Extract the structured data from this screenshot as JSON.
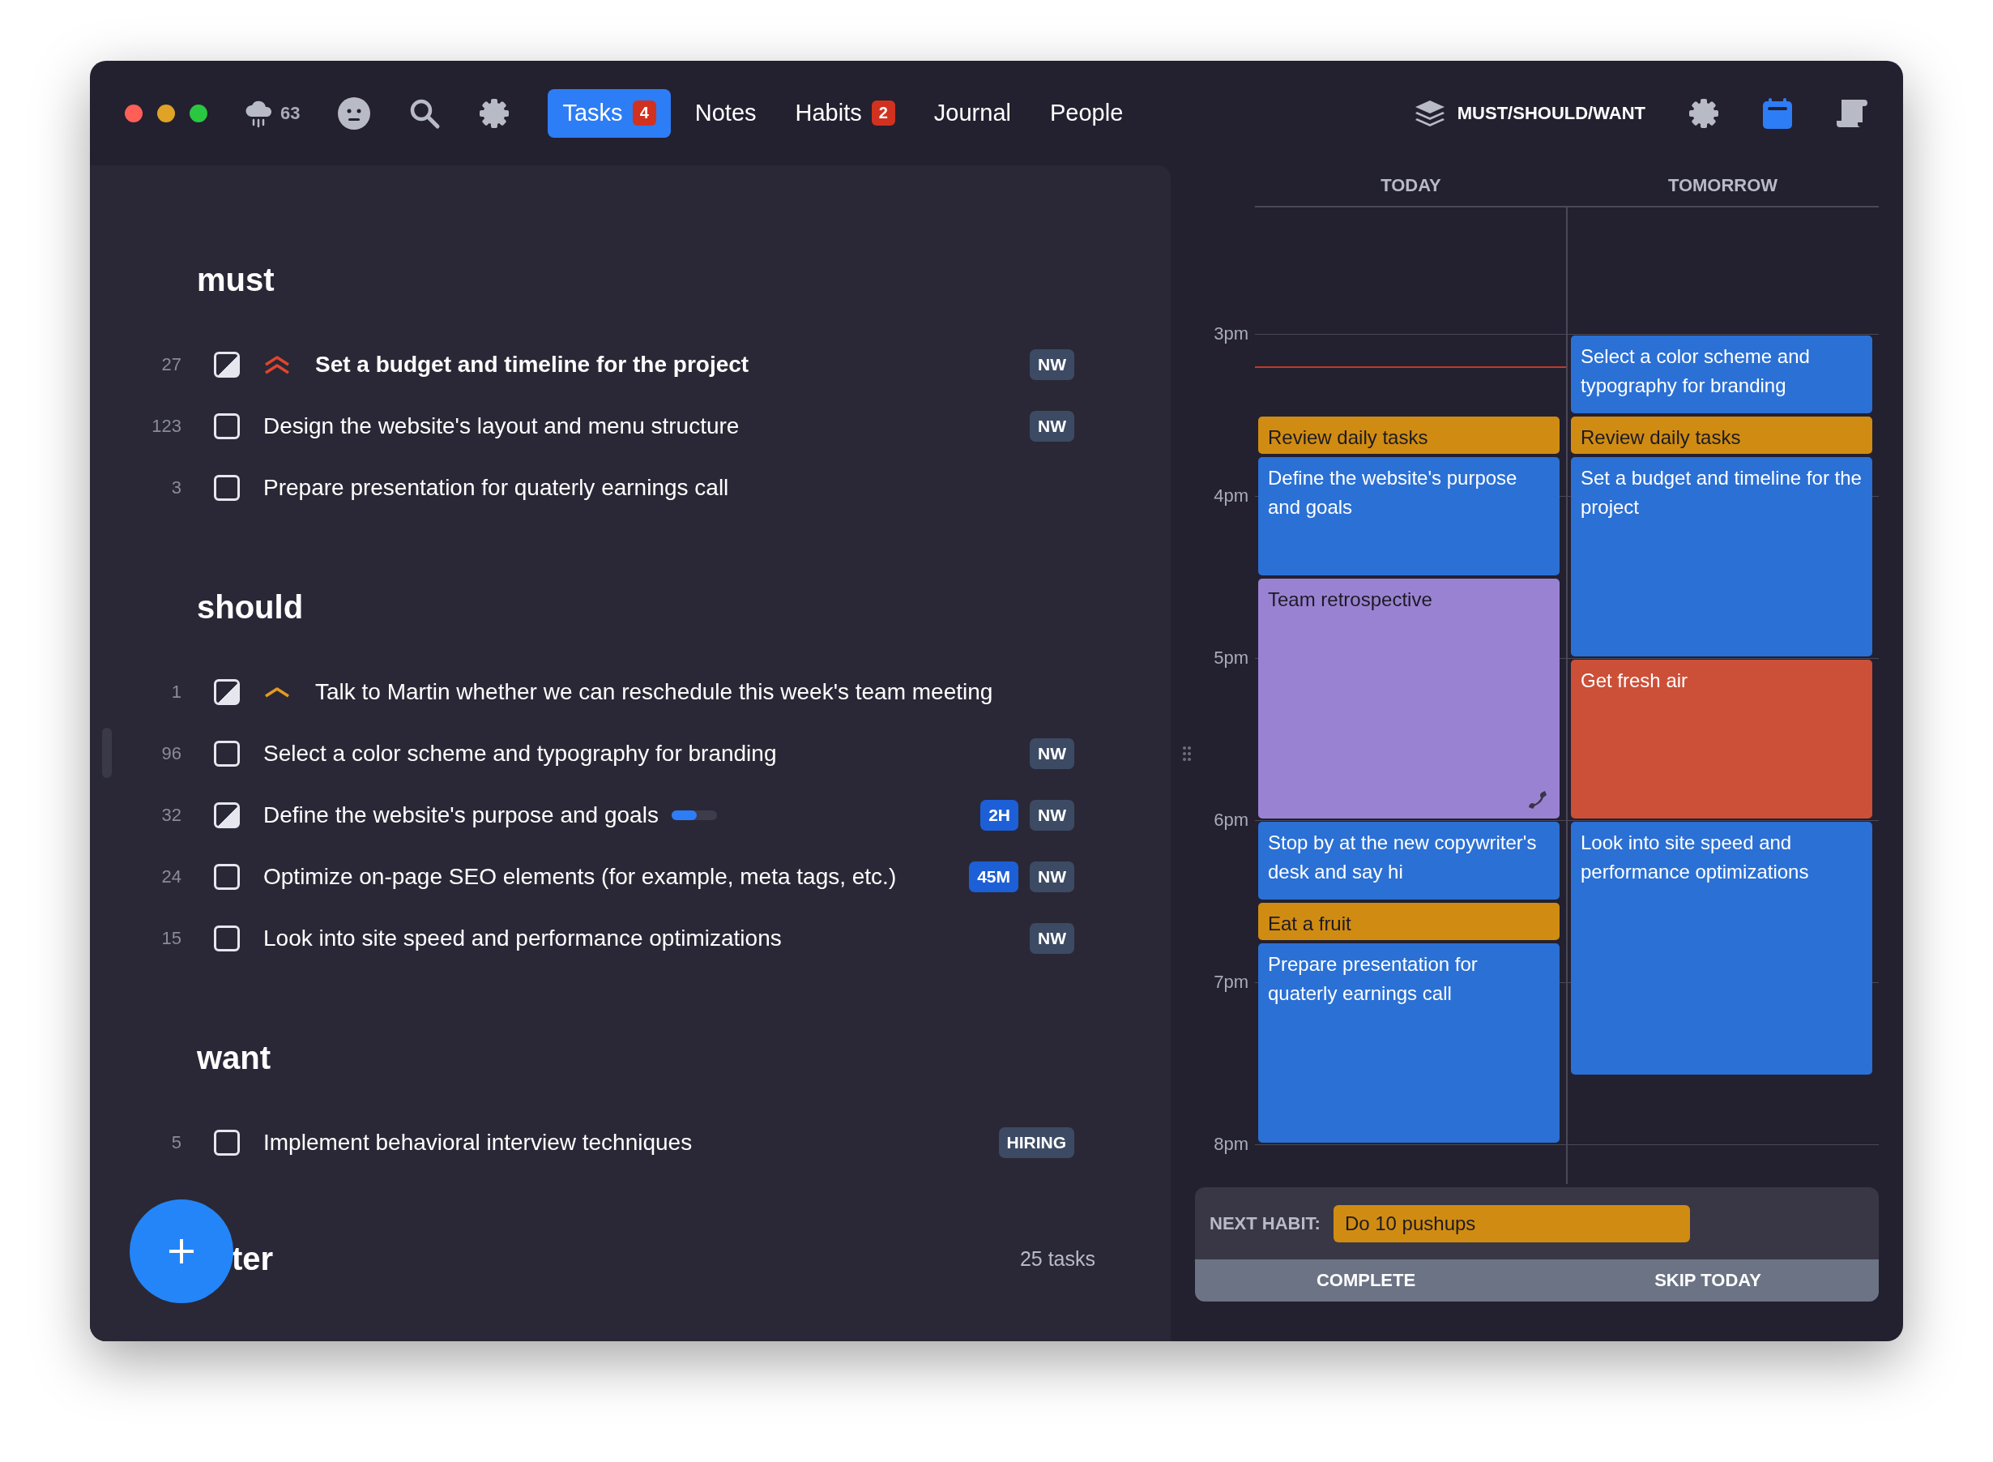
{
  "window": {
    "controls": [
      {
        "color": "#fe5f57"
      },
      {
        "color": "#e0a326"
      },
      {
        "color": "#2ac840"
      }
    ]
  },
  "toolbar": {
    "weather": {
      "temperature": "63"
    },
    "tabs": [
      {
        "label": "Tasks",
        "selected": true,
        "badge": "4"
      },
      {
        "label": "Notes",
        "selected": false
      },
      {
        "label": "Habits",
        "selected": false,
        "badge": "2"
      },
      {
        "label": "Journal",
        "selected": false
      },
      {
        "label": "People",
        "selected": false
      }
    ],
    "view_switch": {
      "label": "MUST/SHOULD/WANT"
    },
    "buttons": [
      {
        "kind": "settings",
        "selected": false
      },
      {
        "kind": "calendar",
        "selected": true
      },
      {
        "kind": "scroll",
        "selected": false
      }
    ]
  },
  "sections": [
    {
      "title": "must",
      "tasks": [
        {
          "number": "27",
          "title": "Set a budget and timeline for the project",
          "in_progress": true,
          "kind": "high",
          "tags": [
            {
              "label": "NW",
              "kind": "project"
            }
          ]
        },
        {
          "number": "123",
          "title": "Design the website's layout and menu structure",
          "in_progress": false,
          "tags": [
            {
              "label": "NW",
              "kind": "project"
            }
          ]
        },
        {
          "number": "3",
          "title": "Prepare presentation for quaterly earnings call",
          "in_progress": false
        }
      ]
    },
    {
      "title": "should",
      "tasks": [
        {
          "number": "1",
          "title": "Talk to Martin whether we can reschedule this week's team meeting",
          "in_progress": true,
          "kind": "medium"
        },
        {
          "number": "96",
          "title": "Select a color scheme and typography for branding",
          "in_progress": false,
          "tags": [
            {
              "label": "NW",
              "kind": "project"
            }
          ]
        },
        {
          "number": "32",
          "title": "Define the website's purpose and goals",
          "in_progress": true,
          "progress": {
            "level": 0.55
          },
          "tags": [
            {
              "label": "2H",
              "kind": "estimate"
            },
            {
              "label": "NW",
              "kind": "project"
            }
          ]
        },
        {
          "number": "24",
          "title": "Optimize on-page SEO elements (for example, meta tags, etc.)",
          "in_progress": false,
          "tags": [
            {
              "label": "45M",
              "kind": "estimate"
            },
            {
              "label": "NW",
              "kind": "project"
            }
          ]
        },
        {
          "number": "15",
          "title": "Look into site speed and performance optimizations",
          "in_progress": false,
          "tags": [
            {
              "label": "NW",
              "kind": "project"
            }
          ]
        }
      ]
    },
    {
      "title": "want",
      "tasks": [
        {
          "number": "5",
          "title": "Implement behavioral interview techniques",
          "in_progress": false,
          "tags": [
            {
              "label": "HIRING",
              "kind": "project"
            }
          ]
        }
      ]
    }
  ],
  "later": {
    "title": "ter",
    "count": "25 tasks"
  },
  "calendar": {
    "hours": [
      "3pm",
      "4pm",
      "5pm",
      "6pm",
      "7pm",
      "8pm"
    ],
    "columns": [
      {
        "label": "TODAY",
        "events": [
          {
            "title": "Review daily tasks",
            "kind": "habit",
            "color": "#d08c12"
          },
          {
            "title": "Define the website's purpose and goals",
            "kind": "task",
            "color": "#2b70d4"
          },
          {
            "title": "Team retrospective",
            "kind": "call",
            "color": "#9a82d2"
          },
          {
            "title": "Stop by at the new copywriter's desk and say hi",
            "kind": "task",
            "color": "#2b70d4"
          },
          {
            "title": "Eat a fruit",
            "kind": "habit",
            "color": "#d08c12"
          },
          {
            "title": "Prepare presentation for quaterly earnings call",
            "kind": "task",
            "color": "#2b70d4"
          }
        ]
      },
      {
        "label": "TOMORROW",
        "events": [
          {
            "title": "Select a color scheme and typography for branding",
            "kind": "task",
            "color": "#2b70d4"
          },
          {
            "title": "Review daily tasks",
            "kind": "habit",
            "color": "#d08c12"
          },
          {
            "title": "Set a budget and timeline for the project",
            "kind": "task",
            "color": "#2b70d4"
          },
          {
            "title": "Get fresh air",
            "kind": "break",
            "color": "#cc4f38"
          },
          {
            "title": "Look into site speed and performance optimizations",
            "kind": "task",
            "color": "#2b70d4"
          }
        ]
      }
    ]
  },
  "habit": {
    "label": "NEXT HABIT:",
    "name": "Do 10 pushups",
    "actions": [
      "COMPLETE",
      "SKIP TODAY"
    ]
  }
}
